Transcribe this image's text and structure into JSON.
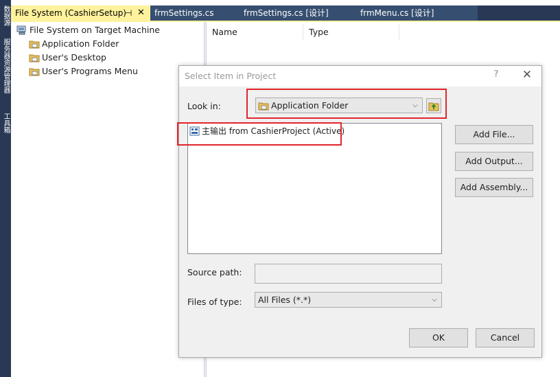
{
  "side_strip": {
    "labels": [
      "数据源",
      "服务器资源管理器",
      "工具箱"
    ]
  },
  "tabs": [
    {
      "label": "File System (CashierSetup)",
      "active": true
    },
    {
      "label": "frmSettings.cs",
      "active": false
    },
    {
      "label": "frmSettings.cs [设计]",
      "active": false
    },
    {
      "label": "frmMenu.cs [设计]",
      "active": false
    }
  ],
  "tab_icons": {
    "pin": "pin-icon",
    "close": "close-icon"
  },
  "tree": {
    "root": "File System on Target Machine",
    "children": [
      "Application Folder",
      "User's Desktop",
      "User's Programs Menu"
    ]
  },
  "list_columns": [
    "Name",
    "Type"
  ],
  "dialog": {
    "title": "Select Item in Project",
    "help": "?",
    "close": "✕",
    "look_in_label": "Look in:",
    "look_in_value": "Application Folder",
    "items": [
      "主输出 from CashierProject (Active)"
    ],
    "add_file": "Add File...",
    "add_output": "Add Output...",
    "add_assembly": "Add Assembly...",
    "source_path_label": "Source path:",
    "source_path_value": "",
    "files_of_type_label": "Files of type:",
    "files_of_type_value": "All Files (*.*)",
    "ok": "OK",
    "cancel": "Cancel"
  },
  "colors": {
    "chrome": "#293955",
    "active_tab": "#fff29d",
    "highlight": "#e1252b"
  }
}
